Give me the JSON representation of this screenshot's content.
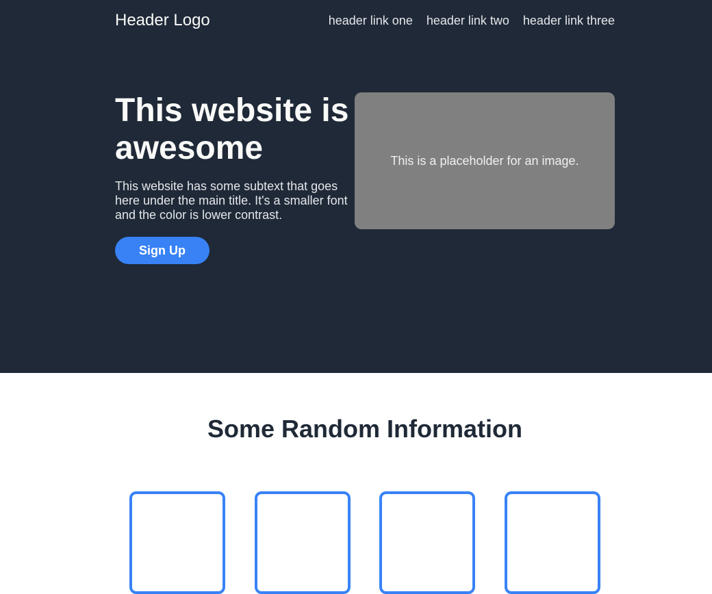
{
  "header": {
    "logo": "Header Logo",
    "links": [
      "header link one",
      "header link two",
      "header link three"
    ]
  },
  "hero": {
    "title": "This website is awesome",
    "subtext": "This website has some subtext that goes here under the main title. It's a smaller font and the color is lower contrast.",
    "signup_label": "Sign Up",
    "image_placeholder": "This is a placeholder for an image."
  },
  "info": {
    "title": "Some Random Information"
  },
  "colors": {
    "hero_bg": "#1f2937",
    "accent": "#3882f6",
    "placeholder_bg": "#808080"
  }
}
